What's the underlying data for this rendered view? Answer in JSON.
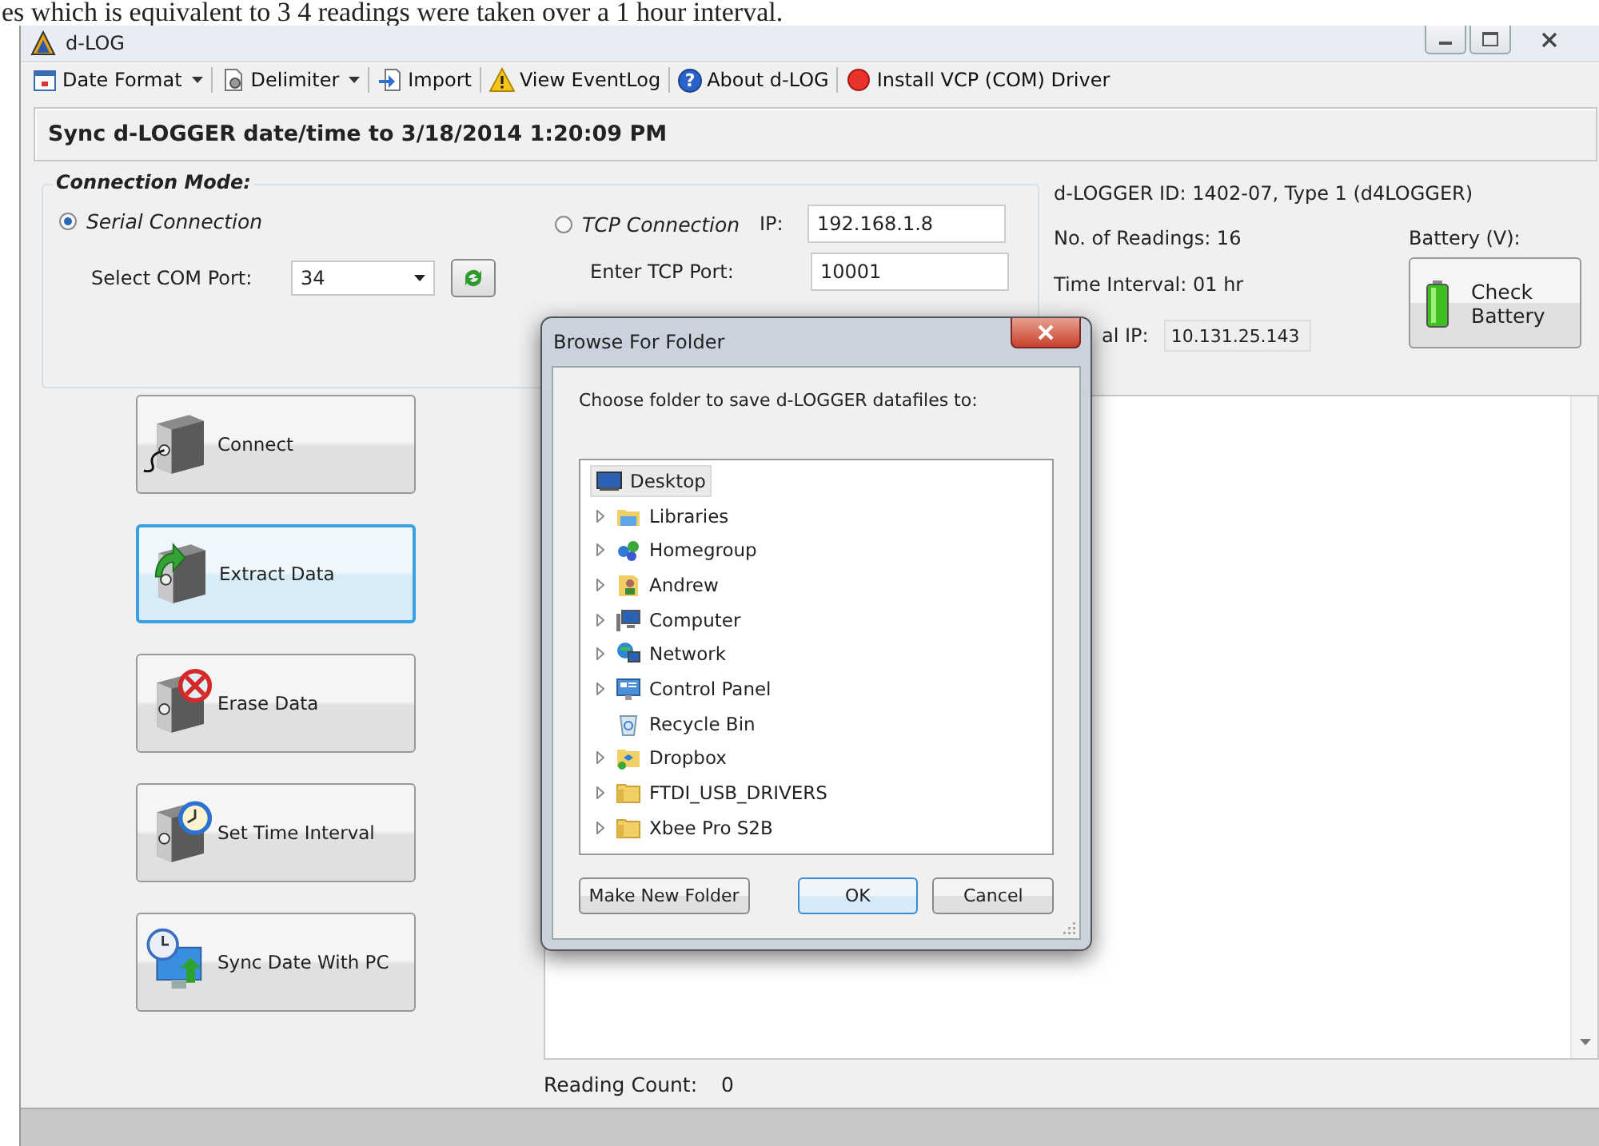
{
  "background_document": {
    "text": "es which is equivalent to 3 4 readings were taken over a 1 hour interval."
  },
  "window": {
    "title": "d-LOG"
  },
  "toolbar": [
    {
      "label": "Date Format",
      "kind": "calendar",
      "dropdown": true
    },
    {
      "label": "Delimiter",
      "kind": "page",
      "dropdown": true
    },
    {
      "label": "Import",
      "kind": "import",
      "dropdown": false
    },
    {
      "label": "View EventLog",
      "kind": "warning",
      "dropdown": false
    },
    {
      "label": "About d-LOG",
      "kind": "help",
      "glyph": "?",
      "dropdown": false
    },
    {
      "label": "Install VCP (COM) Driver",
      "kind": "record",
      "dropdown": false
    }
  ],
  "sync_banner": "Sync d-LOGGER date/time to 3/18/2014 1:20:09 PM",
  "connection": {
    "legend": "Connection Mode:",
    "modes": [
      {
        "label": "Serial Connection",
        "selected": true
      },
      {
        "label": "TCP Connection",
        "selected": false
      }
    ],
    "com_port_label": "Select COM Port:",
    "com_port_value": "34",
    "ip_label": "IP:",
    "ip_value": "192.168.1.8",
    "tcp_port_label": "Enter TCP Port:",
    "tcp_port_value": "10001"
  },
  "info": {
    "logger_id": "d-LOGGER ID: 1402-07, Type 1 (d4LOGGER)",
    "readings": "No. of Readings: 16",
    "interval": "Time Interval: 01 hr",
    "ip_label": "al IP:",
    "ip_value": "10.131.25.143",
    "battery_label": "Battery (V):",
    "battery_button": "Check Battery"
  },
  "actions": [
    {
      "label": "Connect",
      "kind": "plug",
      "focused": false
    },
    {
      "label": "Extract Data",
      "kind": "extract",
      "focused": true
    },
    {
      "label": "Erase Data",
      "kind": "erase",
      "focused": false
    },
    {
      "label": "Set Time Interval",
      "kind": "clock",
      "focused": false
    },
    {
      "label": "Sync Date With PC",
      "kind": "sync",
      "focused": false
    }
  ],
  "reading_count": {
    "label": "Reading Count:",
    "value": "0"
  },
  "dialog": {
    "title": "Browse For Folder",
    "prompt": "Choose folder to save d-LOGGER datafiles to:",
    "tree": [
      {
        "label": "Desktop",
        "kind": "desktop",
        "selected": true,
        "expandable": false,
        "children": [
          {
            "label": "Libraries",
            "kind": "libraries",
            "selected": false,
            "expandable": true
          },
          {
            "label": "Homegroup",
            "kind": "homegroup",
            "selected": false,
            "expandable": true
          },
          {
            "label": "Andrew",
            "kind": "user",
            "selected": false,
            "expandable": true
          },
          {
            "label": "Computer",
            "kind": "computer",
            "selected": false,
            "expandable": true
          },
          {
            "label": "Network",
            "kind": "network",
            "selected": false,
            "expandable": true
          },
          {
            "label": "Control Panel",
            "kind": "control",
            "selected": false,
            "expandable": true
          },
          {
            "label": "Recycle Bin",
            "kind": "bin",
            "selected": false,
            "expandable": false
          },
          {
            "label": "Dropbox",
            "kind": "dropbox",
            "selected": false,
            "expandable": true
          },
          {
            "label": "FTDI_USB_DRIVERS",
            "kind": "folder",
            "selected": false,
            "expandable": true
          },
          {
            "label": "Xbee Pro S2B",
            "kind": "folder",
            "selected": false,
            "expandable": true
          }
        ]
      }
    ],
    "buttons": [
      {
        "label": "Make New Folder",
        "default": false
      },
      {
        "label": "OK",
        "default": true
      },
      {
        "label": "Cancel",
        "default": false
      }
    ]
  }
}
